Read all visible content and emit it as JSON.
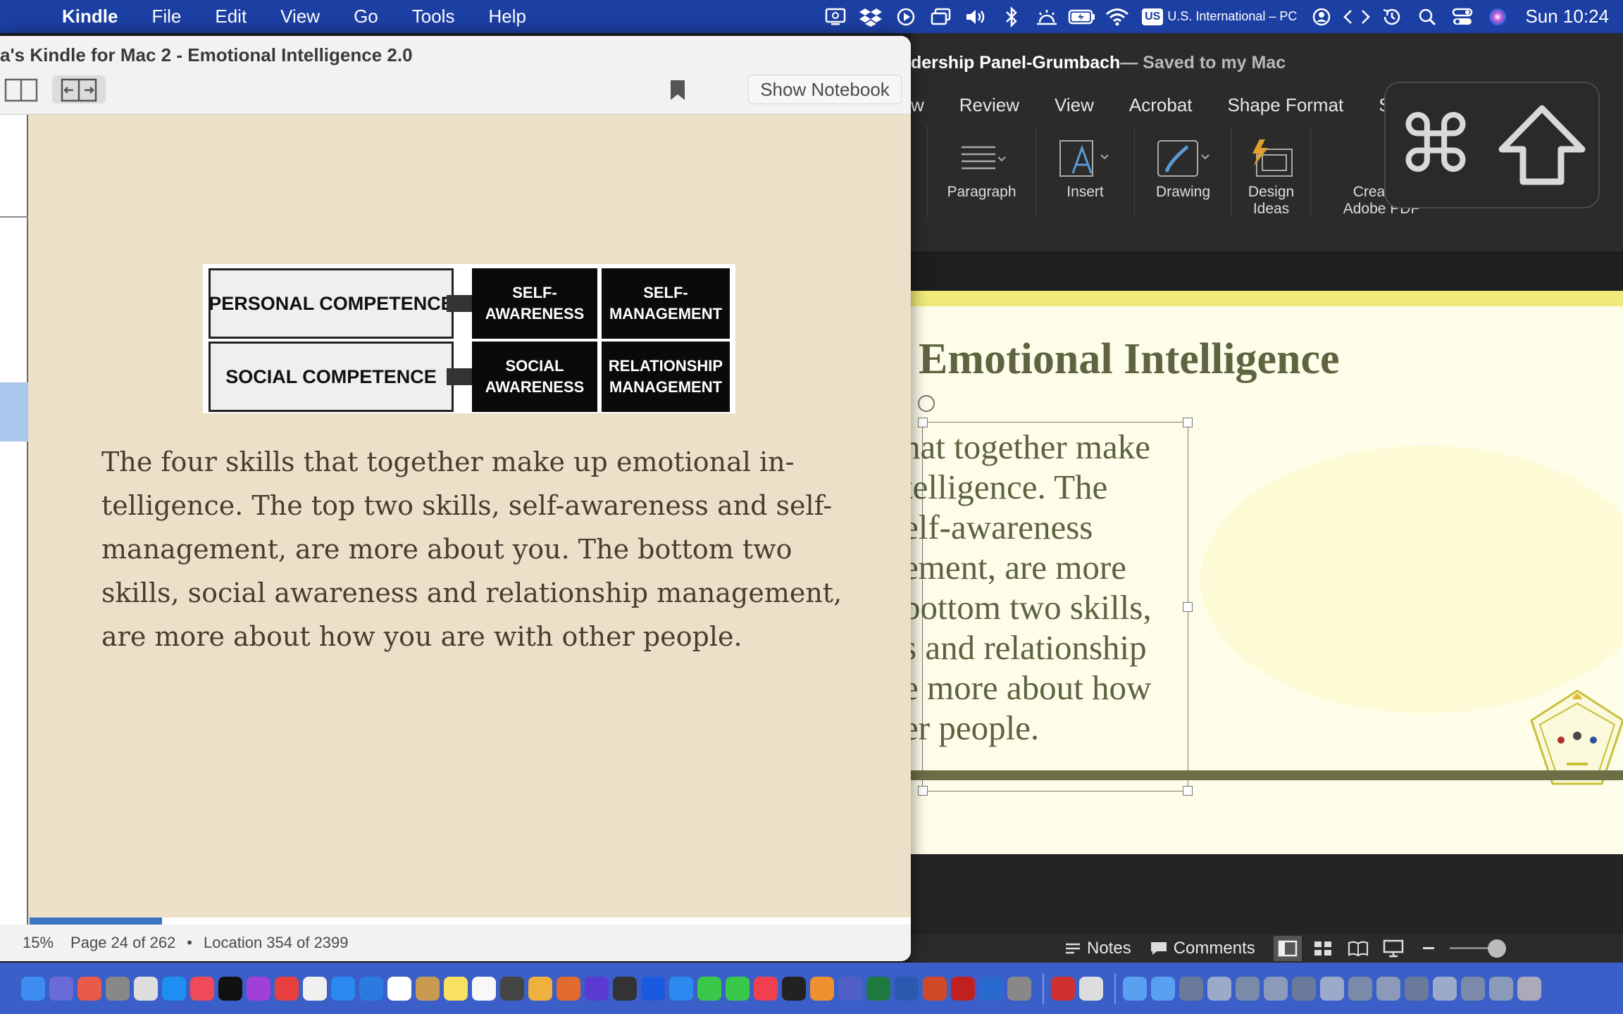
{
  "menubar": {
    "app_name": "Kindle",
    "menus": [
      "File",
      "Edit",
      "View",
      "Go",
      "Tools",
      "Help"
    ],
    "keyboard_flag": "US",
    "keyboard_layout": "U.S. International – PC",
    "clock": "Sun  10:24"
  },
  "kindle": {
    "window_title": "a's Kindle for Mac 2 - Emotional Intelligence 2.0",
    "show_notebook": "Show Notebook",
    "figure": {
      "row1_label": "PERSONAL COMPETENCE",
      "row2_label": "SOCIAL COMPETENCE",
      "cells": [
        "SELF-\nAWARENESS",
        "SELF-\nMANAGEMENT",
        "SOCIAL\nAWARENESS",
        "RELATIONSHIP\nMANAGEMENT"
      ]
    },
    "body_text": "The four skills that together make up emotional in-\ntelligence. The top two skills, self-awareness and self-\nmanagement, are more about you. The bottom two\nskills, social awareness and relationship management,\nare more about how you are with other people.",
    "progress_percent": "15%",
    "progress_fraction": 0.15,
    "page_info": "Page 24 of 262",
    "location_info": "Location 354 of 2399",
    "bullet": "•"
  },
  "ppt": {
    "doc_title": "dership Panel-Grumbach",
    "saved_status": " — Saved to my Mac",
    "tabs": [
      "w",
      "Review",
      "View",
      "Acrobat",
      "Shape Format",
      "Sh"
    ],
    "ribbon": {
      "paragraph": "Paragraph",
      "insert": "Insert",
      "drawing": "Drawing",
      "design_ideas": "Design\nIdeas",
      "create_pdf": "Create a\nAdobe PDF"
    },
    "slide_title": "Emotional Intelligence",
    "slide_text": "hat together make\ntelligence. The\nelf-awareness\nement, are more\nbottom two skills,\ns and relationship\ne more about how\ner people.",
    "status_notes": "Notes",
    "status_comments": "Comments"
  },
  "colors": {
    "menubar": "#1c3fa3",
    "kindle_page": "#ece0c9",
    "progress": "#3a74c4",
    "slide_text": "#5d6341"
  }
}
